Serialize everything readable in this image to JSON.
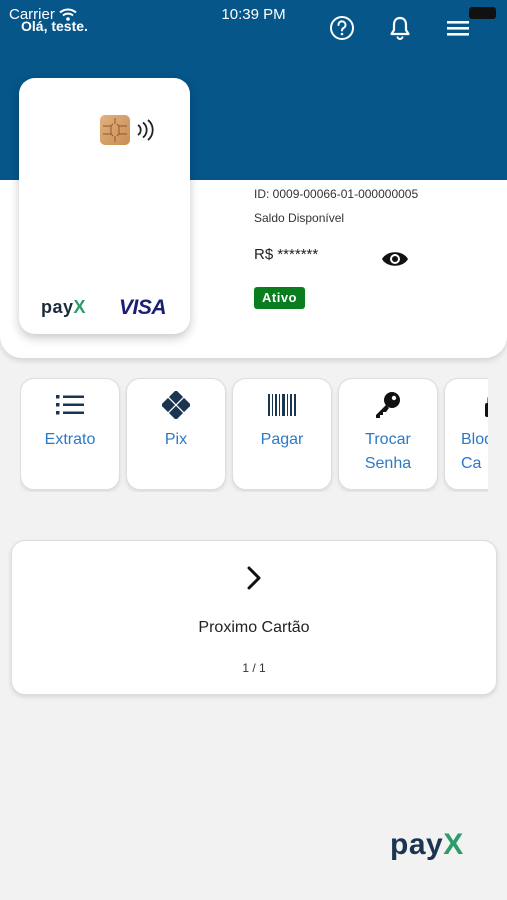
{
  "status_bar": {
    "carrier": "Carrier",
    "time": "10:39 PM"
  },
  "header": {
    "greeting": "Olá, teste.",
    "icons": [
      "help-icon",
      "bell-icon",
      "menu-icon"
    ]
  },
  "card": {
    "brand_logo": "payx",
    "network": "VISA"
  },
  "account": {
    "id_text": "ID: 0009-00066-01-000000005",
    "balance_label": "Saldo Disponível",
    "balance_value": "R$ *******",
    "status": "Ativo"
  },
  "actions": [
    {
      "label": "Extrato",
      "icon": "list-icon"
    },
    {
      "label": "Pix",
      "icon": "pix-icon"
    },
    {
      "label": "Pagar",
      "icon": "barcode-icon"
    },
    {
      "label": "Trocar Senha",
      "icon": "key-icon"
    },
    {
      "label": "Bloq Ca",
      "icon": "lock-icon"
    }
  ],
  "next_card": {
    "label": "Proximo Cartão",
    "count": "1 / 1"
  },
  "footer": {
    "logo": "payx"
  },
  "colors": {
    "primary": "#06568a",
    "action_text": "#2c79c8",
    "status_active": "#0a7d1f",
    "logo_x": "#2e9b6a"
  }
}
